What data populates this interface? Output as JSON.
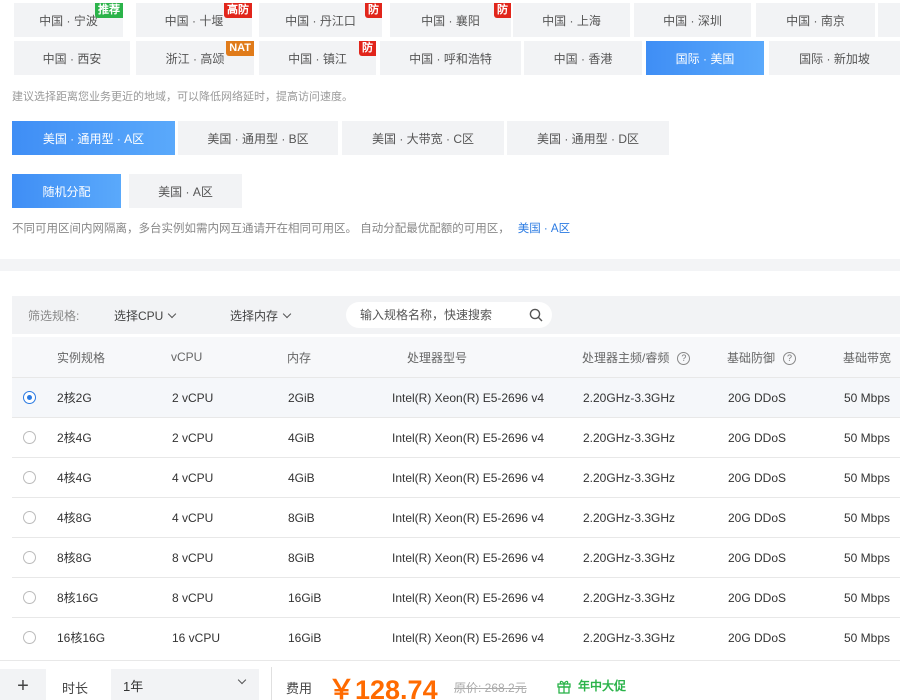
{
  "regions": [
    {
      "label": "中国 · 宁波",
      "badge": "推荐",
      "badge_color": "green"
    },
    {
      "label": "中国 · 十堰",
      "badge": "高防",
      "badge_color": "red"
    },
    {
      "label": "中国 · 丹江口",
      "badge": "防",
      "badge_color": "red"
    },
    {
      "label": "中国 · 襄阳",
      "badge": "防",
      "badge_color": "red"
    },
    {
      "label": "中国 · 上海",
      "badge": "",
      "badge_color": ""
    },
    {
      "label": "中国 · 深圳",
      "badge": "",
      "badge_color": ""
    },
    {
      "label": "中国 · 南京",
      "badge": "",
      "badge_color": ""
    },
    {
      "label": "中国 · 西安",
      "badge": "",
      "badge_color": ""
    },
    {
      "label": "浙江 · 高颂",
      "badge": "NAT",
      "badge_color": "orange"
    },
    {
      "label": "中国 · 镇江",
      "badge": "防",
      "badge_color": "red"
    },
    {
      "label": "中国 · 呼和浩特",
      "badge": "",
      "badge_color": ""
    },
    {
      "label": "中国 · 香港",
      "badge": "",
      "badge_color": ""
    },
    {
      "label": "国际 · 美国",
      "badge": "",
      "badge_color": "",
      "active": true
    },
    {
      "label": "国际 · 新加坡",
      "badge": "",
      "badge_color": ""
    }
  ],
  "region_hint": "建议选择距离您业务更近的地域，可以降低网络延时，提高访问速度。",
  "zones": [
    {
      "label": "美国 · 通用型 · A区",
      "active": true
    },
    {
      "label": "美国 · 通用型 · B区"
    },
    {
      "label": "美国 · 大带宽 · C区"
    },
    {
      "label": "美国 · 通用型 · D区"
    }
  ],
  "allocation": [
    {
      "label": "随机分配",
      "active": true
    },
    {
      "label": "美国 · A区"
    }
  ],
  "notice": {
    "text": "不同可用区间内网隔离，多台实例如需内网互通请开在相同可用区。 自动分配最优配额的可用区，",
    "link": "美国 · A区"
  },
  "filter": {
    "label": "筛选规格:",
    "cpu_select": "选择CPU",
    "mem_select": "选择内存",
    "search_placeholder": "输入规格名称，快速搜索"
  },
  "table": {
    "headers": [
      "实例规格",
      "vCPU",
      "内存",
      "处理器型号",
      "处理器主频/睿频",
      "基础防御",
      "基础带宽"
    ],
    "rows": [
      {
        "spec": "2核2G",
        "vcpu": "2 vCPU",
        "mem": "2GiB",
        "cpu": "Intel(R) Xeon(R) E5-2696 v4",
        "freq": "2.20GHz-3.3GHz",
        "ddos": "20G DDoS",
        "bw": "50 Mbps",
        "selected": true
      },
      {
        "spec": "2核4G",
        "vcpu": "2 vCPU",
        "mem": "4GiB",
        "cpu": "Intel(R) Xeon(R) E5-2696 v4",
        "freq": "2.20GHz-3.3GHz",
        "ddos": "20G DDoS",
        "bw": "50 Mbps"
      },
      {
        "spec": "4核4G",
        "vcpu": "4 vCPU",
        "mem": "4GiB",
        "cpu": "Intel(R) Xeon(R) E5-2696 v4",
        "freq": "2.20GHz-3.3GHz",
        "ddos": "20G DDoS",
        "bw": "50 Mbps"
      },
      {
        "spec": "4核8G",
        "vcpu": "4 vCPU",
        "mem": "8GiB",
        "cpu": "Intel(R) Xeon(R) E5-2696 v4",
        "freq": "2.20GHz-3.3GHz",
        "ddos": "20G DDoS",
        "bw": "50 Mbps"
      },
      {
        "spec": "8核8G",
        "vcpu": "8 vCPU",
        "mem": "8GiB",
        "cpu": "Intel(R) Xeon(R) E5-2696 v4",
        "freq": "2.20GHz-3.3GHz",
        "ddos": "20G DDoS",
        "bw": "50 Mbps"
      },
      {
        "spec": "8核16G",
        "vcpu": "8 vCPU",
        "mem": "16GiB",
        "cpu": "Intel(R) Xeon(R) E5-2696 v4",
        "freq": "2.20GHz-3.3GHz",
        "ddos": "20G DDoS",
        "bw": "50 Mbps"
      },
      {
        "spec": "16核16G",
        "vcpu": "16 vCPU",
        "mem": "16GiB",
        "cpu": "Intel(R) Xeon(R) E5-2696 v4",
        "freq": "2.20GHz-3.3GHz",
        "ddos": "20G DDoS",
        "bw": "50 Mbps"
      }
    ]
  },
  "footer": {
    "plus": "+",
    "duration_label": "时长",
    "duration_value": "1年",
    "fee_label": "费用",
    "price": "￥128.74",
    "original_price": "原价: 268.2元",
    "promo": "年中大促",
    "promo_icon": "gift-icon"
  },
  "colors": {
    "accent": "#4d9bf7",
    "price": "#ff6a00",
    "promo": "#2bb34a",
    "link": "#2a7ae2"
  }
}
